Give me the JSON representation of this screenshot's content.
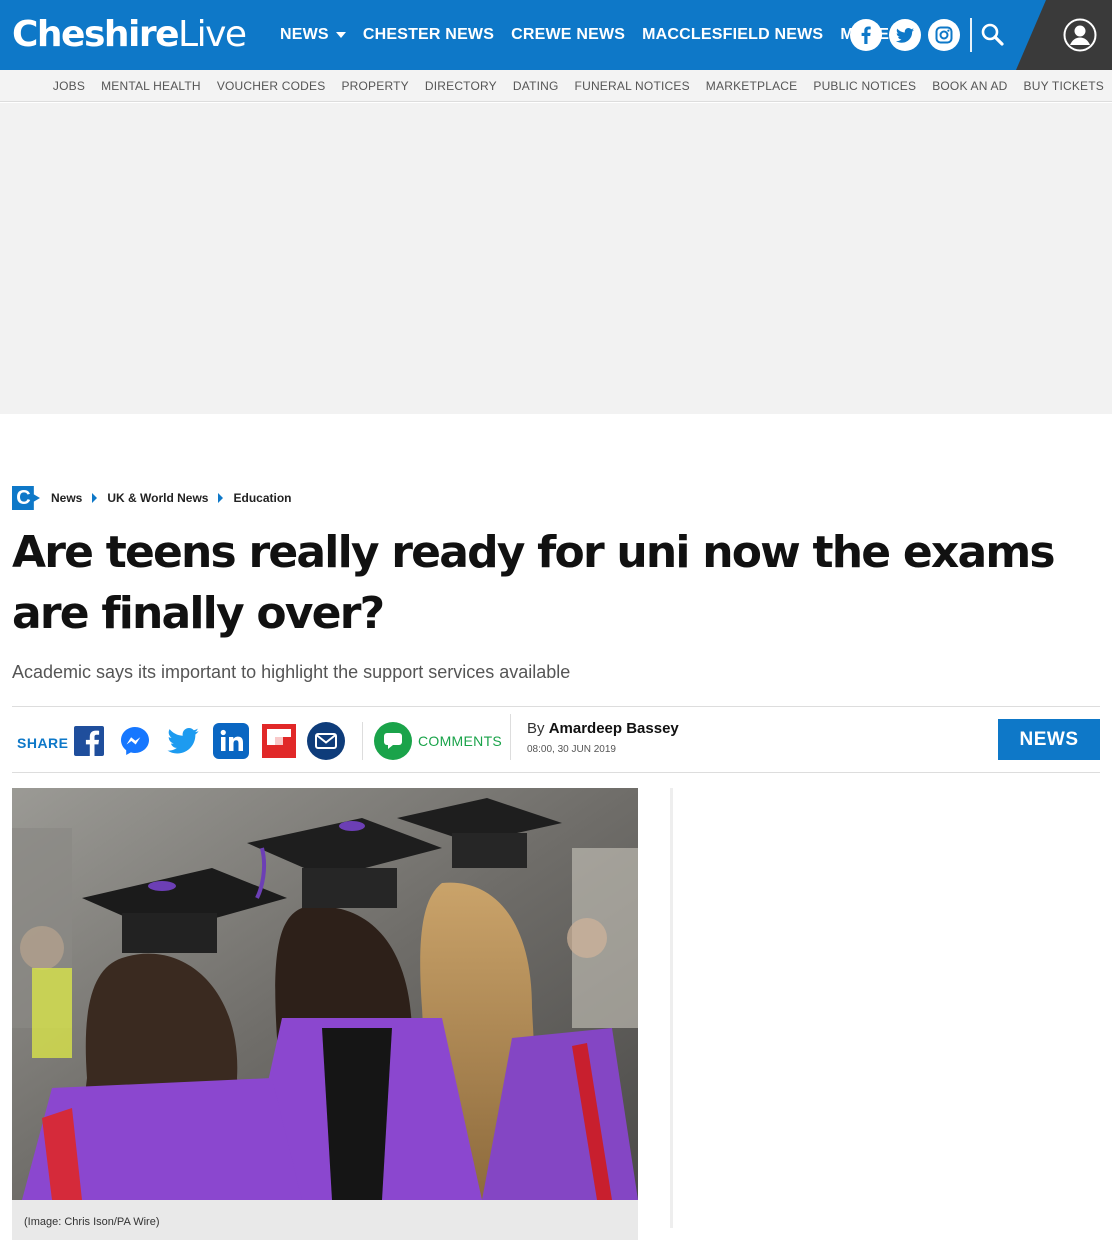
{
  "site": {
    "logo_bold": "Cheshire",
    "logo_light": "Live"
  },
  "colors": {
    "brand": "#0e78c8",
    "account_bg": "#3a3a3a",
    "comments_green": "#1aa34a"
  },
  "main_nav": [
    {
      "label": "NEWS",
      "dropdown": true
    },
    {
      "label": "CHESTER NEWS"
    },
    {
      "label": "CREWE NEWS"
    },
    {
      "label": "MACCLESFIELD NEWS"
    },
    {
      "label": "MORE",
      "dropdown": true
    }
  ],
  "social_icons": [
    "facebook-icon",
    "twitter-icon",
    "instagram-icon"
  ],
  "sub_nav": [
    "JOBS",
    "MENTAL HEALTH",
    "VOUCHER CODES",
    "PROPERTY",
    "DIRECTORY",
    "DATING",
    "FUNERAL NOTICES",
    "MARKETPLACE",
    "PUBLIC NOTICES",
    "BOOK AN AD",
    "BUY TICKETS"
  ],
  "breadcrumb": {
    "badge": "C",
    "items": [
      "News",
      "UK & World News",
      "Education"
    ]
  },
  "article": {
    "headline": "Are teens really ready for uni now the exams are finally over?",
    "subheadline": "Academic says its important to highlight the support services available",
    "byline_prefix": "By",
    "author": "Amardeep Bassey",
    "published": "08:00, 30 JUN 2019",
    "section_badge": "NEWS",
    "image_caption": "(Image: Chris Ison/PA Wire)"
  },
  "share": {
    "label": "SHARE",
    "comments_label": "COMMENTS",
    "icons": [
      "facebook-share-icon",
      "messenger-share-icon",
      "twitter-share-icon",
      "linkedin-share-icon",
      "flipboard-share-icon",
      "email-share-icon"
    ]
  }
}
